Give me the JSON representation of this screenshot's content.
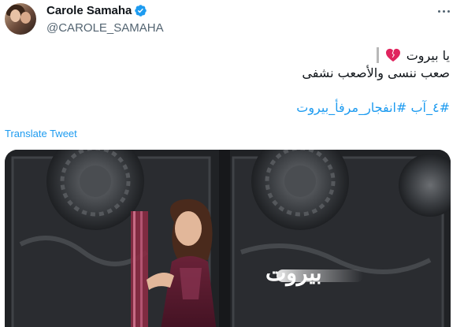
{
  "author": {
    "display_name": "Carole Samaha",
    "handle": "@CAROLE_SAMAHA"
  },
  "tweet": {
    "line1": "يا بيروت",
    "line2": "صعب ننسى والأصعب نشفى",
    "hashtags": "#٤_آب #انفجار_مرفأ_بيروت"
  },
  "actions": {
    "translate_label": "Translate Tweet"
  },
  "media": {
    "caption": "بيروت"
  },
  "icons": {
    "verified": "verified-badge-icon",
    "heart": "broken-heart-icon",
    "more": "more-options-icon"
  },
  "colors": {
    "link": "#1d9bf0",
    "verified": "#1d9bf0",
    "heart": "#e0245e",
    "text": "#0f1419",
    "secondary": "#536471"
  }
}
